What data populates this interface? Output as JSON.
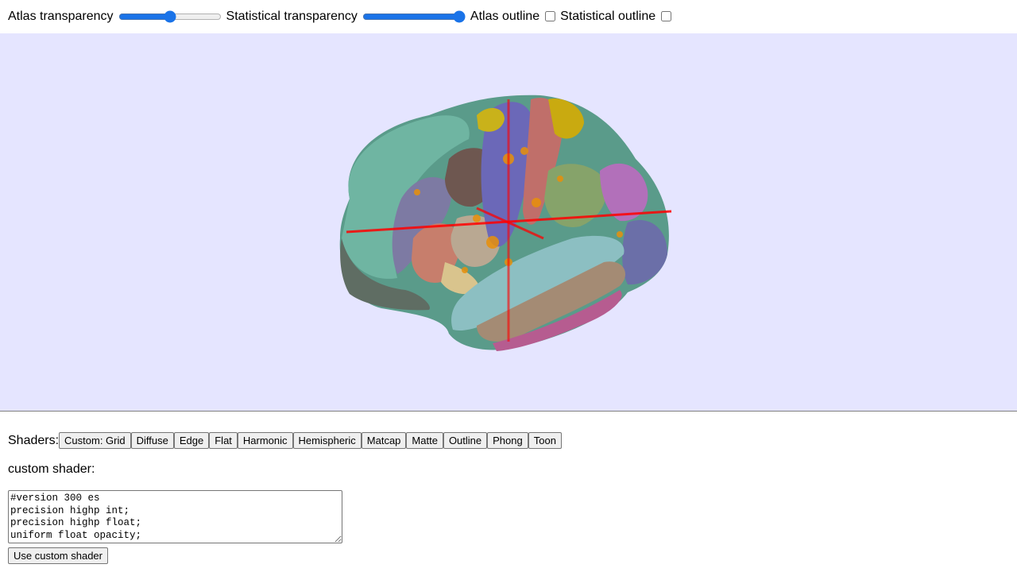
{
  "controls": {
    "atlas_transparency_label": "Atlas transparency",
    "atlas_transparency_value": 0.5,
    "statistical_transparency_label": "Statistical transparency",
    "statistical_transparency_value": 1.0,
    "atlas_outline_label": "Atlas outline",
    "atlas_outline_checked": false,
    "statistical_outline_label": "Statistical outline",
    "statistical_outline_checked": false
  },
  "viewer": {
    "background": "#e5e5ff",
    "crosshair_color": "#ff0000"
  },
  "shaders": {
    "label": "Shaders:",
    "buttons": [
      "Custom: Grid",
      "Diffuse",
      "Edge",
      "Flat",
      "Harmonic",
      "Hemispheric",
      "Matcap",
      "Matte",
      "Outline",
      "Phong",
      "Toon"
    ]
  },
  "custom_shader": {
    "label": "custom shader:",
    "code": "#version 300 es\nprecision highp int;\nprecision highp float;\nuniform float opacity;",
    "button_label": "Use custom shader"
  }
}
